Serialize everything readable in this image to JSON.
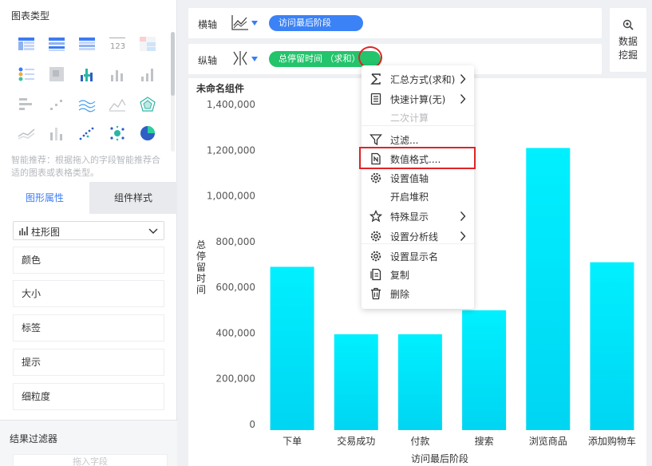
{
  "left_panel": {
    "chart_types_title": "图表类型",
    "smart_tip": "智能推荐：根据拖入的字段智能推荐合适的图表或表格类型。",
    "tabs": {
      "graph_props": "图形属性",
      "component_style": "组件样式"
    },
    "chart_select": {
      "value": "柱形图"
    },
    "props": [
      "颜色",
      "大小",
      "标签",
      "提示",
      "细粒度"
    ],
    "result_filter_title": "结果过滤器",
    "filter_placeholder": "拖入字段"
  },
  "axes": {
    "x_label": "横轴",
    "y_label": "纵轴",
    "x_field": "访问最后阶段",
    "y_field": "总停留时间 （求和）"
  },
  "data_mining": {
    "label": "数据挖掘"
  },
  "component_name": "未命名组件",
  "menu": {
    "items": [
      {
        "label": "汇总方式(求和)",
        "icon": "sigma-icon",
        "submenu": true
      },
      {
        "label": "快速计算(无)",
        "icon": "calculator-icon",
        "submenu": true
      },
      {
        "label": "二次计算",
        "icon": "",
        "disabled": true
      },
      {
        "label": "过滤...",
        "icon": "filter-icon"
      },
      {
        "label": "数值格式....",
        "icon": "number-format-icon"
      },
      {
        "label": "设置值轴",
        "icon": "gear-icon"
      },
      {
        "label": "开启堆积",
        "icon": ""
      },
      {
        "label": "特殊显示",
        "icon": "star-icon",
        "submenu": true
      },
      {
        "label": "设置分析线",
        "icon": "gear-icon",
        "submenu": true
      },
      {
        "label": "设置显示名",
        "icon": "gear-icon"
      },
      {
        "label": "复制",
        "icon": "copy-icon"
      },
      {
        "label": "删除",
        "icon": "trash-icon"
      }
    ]
  },
  "colors": {
    "accent": "#3b82f6",
    "green": "#23c46b",
    "bar_top": "#00f0ff",
    "bar_bottom": "#00d5f2",
    "highlight": "#e02424"
  },
  "chart_data": {
    "type": "bar",
    "categories": [
      "下单",
      "交易成功",
      "付款",
      "搜索",
      "浏览商品",
      "添加购物车"
    ],
    "values": [
      690000,
      395000,
      395000,
      500000,
      1210000,
      710000
    ],
    "xlabel": "访问最后阶段",
    "ylabel": "总停留时间",
    "ylim": [
      0,
      1400000
    ],
    "yticks": [
      0,
      200000,
      400000,
      600000,
      800000,
      1000000,
      1200000,
      1400000
    ],
    "ytick_labels": [
      "0",
      "200,000",
      "400,000",
      "600,000",
      "800,000",
      "1,000,000",
      "1,200,000",
      "1,400,000"
    ],
    "grid": false
  }
}
